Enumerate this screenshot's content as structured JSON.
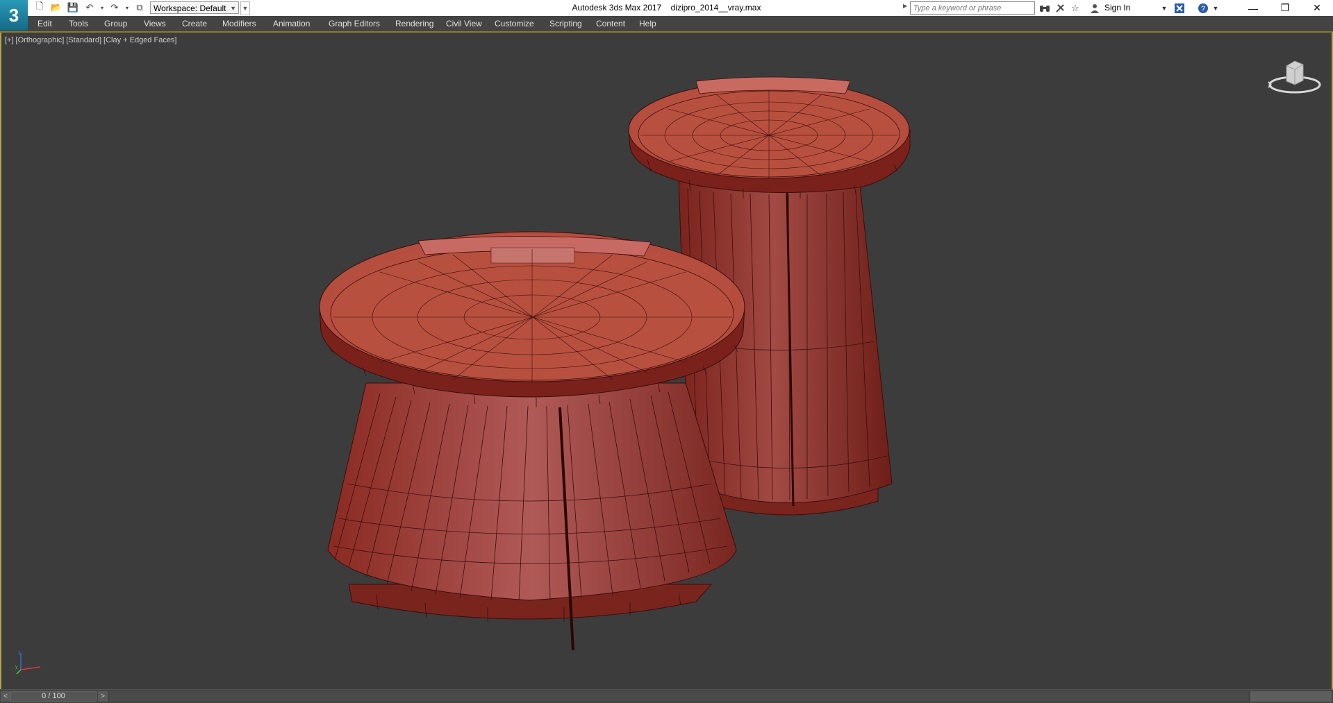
{
  "app": {
    "name": "Autodesk 3ds Max 2017",
    "file": "dizipro_2014__vray.max",
    "logo_text": "3"
  },
  "quick_access": {
    "workspace_label": "Workspace: Default"
  },
  "infocenter": {
    "search_placeholder": "Type a keyword or phrase",
    "sign_in_label": "Sign In"
  },
  "menu": {
    "items": [
      "Edit",
      "Tools",
      "Group",
      "Views",
      "Create",
      "Modifiers",
      "Animation",
      "Graph Editors",
      "Rendering",
      "Civil View",
      "Customize",
      "Scripting",
      "Content",
      "Help"
    ]
  },
  "viewport": {
    "labels": [
      "[+]",
      "[Orthographic]",
      "[Standard]",
      "[Clay + Edged Faces]"
    ],
    "object_color": "#a8443a",
    "edge_color": "#3a0d0a",
    "background_color": "#3c3c3c"
  },
  "timeline": {
    "frame_display": "0 / 100",
    "prev_label": "<",
    "next_label": ">"
  }
}
